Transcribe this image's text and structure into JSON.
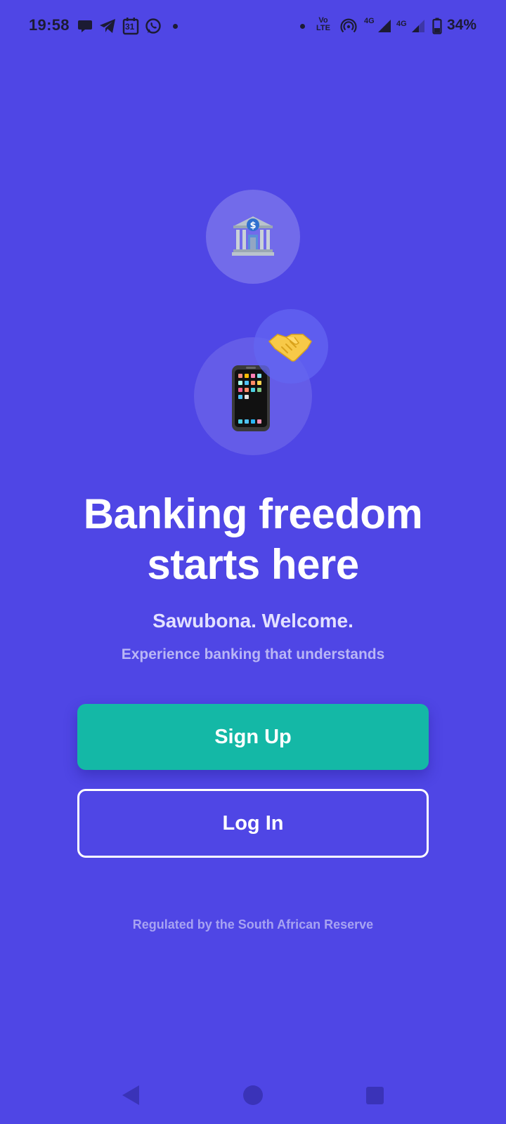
{
  "status_bar": {
    "time": "19:58",
    "left_icons": [
      "message-icon",
      "telegram-icon",
      "calendar-icon",
      "whatsapp-icon"
    ],
    "calendar_day": "31",
    "volte_top": "Vo",
    "volte_bottom": "LTE",
    "network_1": "4G",
    "network_2": "4G",
    "battery": "34%"
  },
  "illustration": {
    "icons": [
      "bank-icon",
      "handshake-icon",
      "mobile-phone-icon"
    ]
  },
  "hero": {
    "headline_line1": "Banking freedom",
    "headline_line2": "starts here",
    "greeting": "Sawubona. Welcome.",
    "subtext": "Experience banking that understands"
  },
  "actions": {
    "signup_label": "Sign Up",
    "login_label": "Log In"
  },
  "footer": {
    "text": "Regulated by the South African Reserve"
  },
  "colors": {
    "background": "#4f46e5",
    "primary_button": "#14b8a6",
    "text_primary": "#ffffff"
  },
  "nav_bar": {
    "icons": [
      "back-icon",
      "home-icon",
      "recents-icon"
    ]
  }
}
